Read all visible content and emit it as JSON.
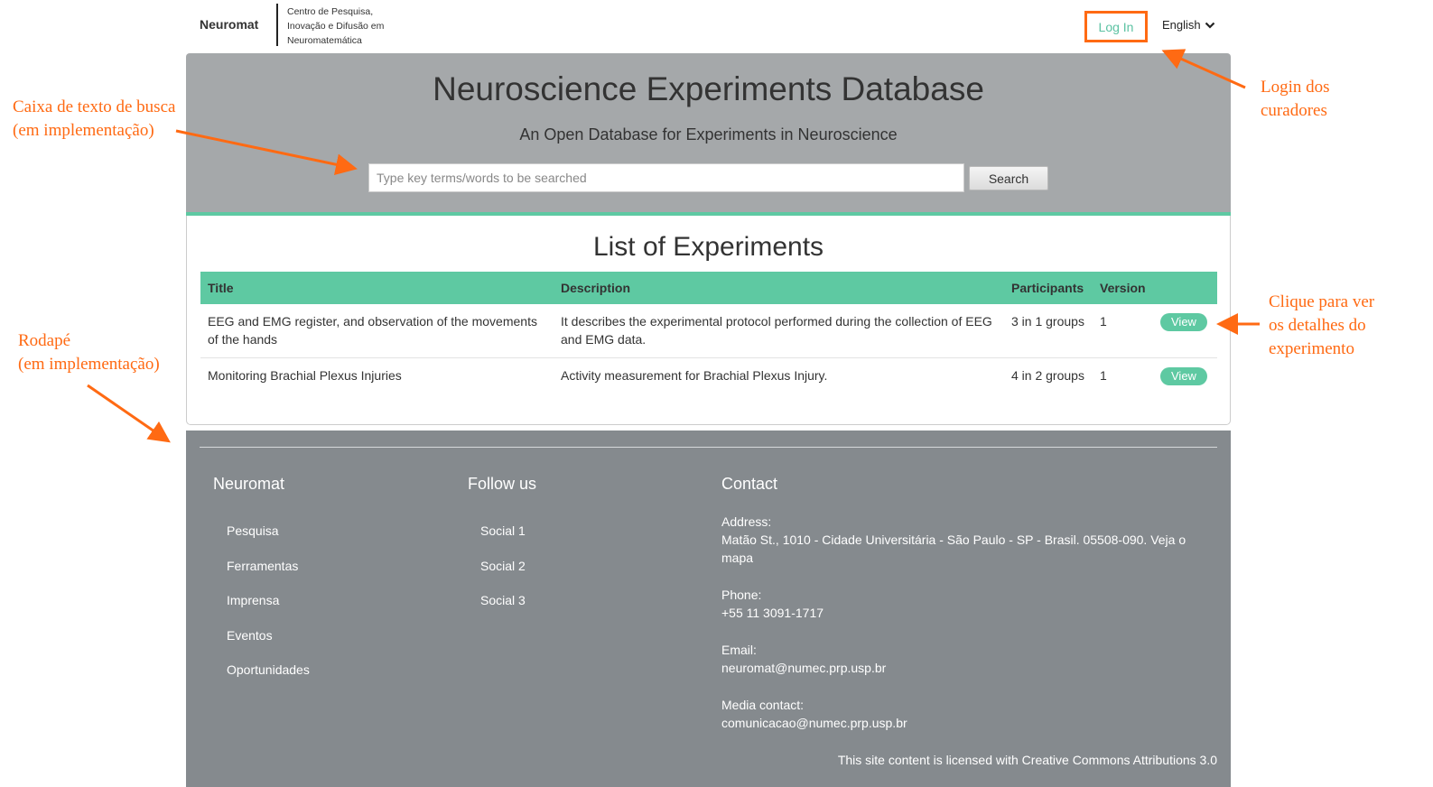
{
  "header": {
    "brand": "Neuromat",
    "brand_sub": [
      "Centro de Pesquisa,",
      "Inovação e Difusão em",
      "Neuromatemática"
    ],
    "login": "Log In",
    "language": "English",
    "language_icon": "chevron-down-icon"
  },
  "hero": {
    "title": "Neuroscience Experiments Database",
    "subtitle": "An Open Database for Experiments in Neuroscience",
    "search_placeholder": "Type key terms/words to be searched",
    "search_button": "Search"
  },
  "experiments": {
    "title": "List of Experiments",
    "columns": [
      "Title",
      "Description",
      "Participants",
      "Version",
      ""
    ],
    "rows": [
      {
        "title": "EEG and EMG register, and observation of the movements of the hands",
        "description": "It describes the experimental protocol performed during the collection of EEG and EMG data.",
        "participants": "3 in 1 groups",
        "version": "1",
        "action": "View"
      },
      {
        "title": "Monitoring Brachial Plexus Injuries",
        "description": "Activity measurement for Brachial Plexus Injury.",
        "participants": "4 in 2 groups",
        "version": "1",
        "action": "View"
      }
    ]
  },
  "footer": {
    "col1": {
      "title": "Neuromat",
      "links": [
        "Pesquisa",
        "Ferramentas",
        "Imprensa",
        "Eventos",
        "Oportunidades"
      ]
    },
    "col2": {
      "title": "Follow us",
      "links": [
        "Social 1",
        "Social 2",
        "Social 3"
      ]
    },
    "col3": {
      "title": "Contact",
      "address_label": "Address:",
      "address": "Matão St., 1010 - Cidade Universitária - São Paulo - SP - Brasil. 05508-090. Veja o mapa",
      "phone_label": "Phone:",
      "phone": "+55 11 3091-1717",
      "email_label": "Email:",
      "email": "neuromat@numec.prp.usp.br",
      "media_label": "Media contact:",
      "media": "comunicacao@numec.prp.usp.br"
    },
    "license": "This site content is licensed with Creative Commons Attributions 3.0"
  },
  "annotations": {
    "search": [
      "Caixa de texto de busca",
      "(em implementação)"
    ],
    "footer": [
      "Rodapé",
      "(em implementação)"
    ],
    "login": [
      "Login dos",
      "curadores"
    ],
    "view": [
      "Clique para ver",
      "os detalhes do",
      "experimento"
    ],
    "color": "#ff6a13"
  },
  "colors": {
    "accent": "#5ec9a2",
    "hero_bg": "#a5a8aa",
    "footer_bg": "#858a8e"
  }
}
